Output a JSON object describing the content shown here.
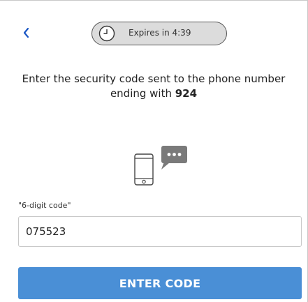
{
  "header": {
    "back_icon": "chevron-left-icon",
    "timer": {
      "icon": "clock-icon",
      "text": "Expires in 4:39"
    }
  },
  "message": {
    "text_before": "Enter the security code sent to the phone number ending with ",
    "digits": "924"
  },
  "illustration": {
    "icon": "phone-message-icon"
  },
  "form": {
    "label": "\"6-digit code\"",
    "value": "075523"
  },
  "actions": {
    "submit_label": "ENTER CODE"
  },
  "colors": {
    "accent": "#4a8fd6",
    "pill_bg": "#dcdcdc",
    "back_arrow": "#1a56c4",
    "bubble": "#7a7a7a"
  }
}
